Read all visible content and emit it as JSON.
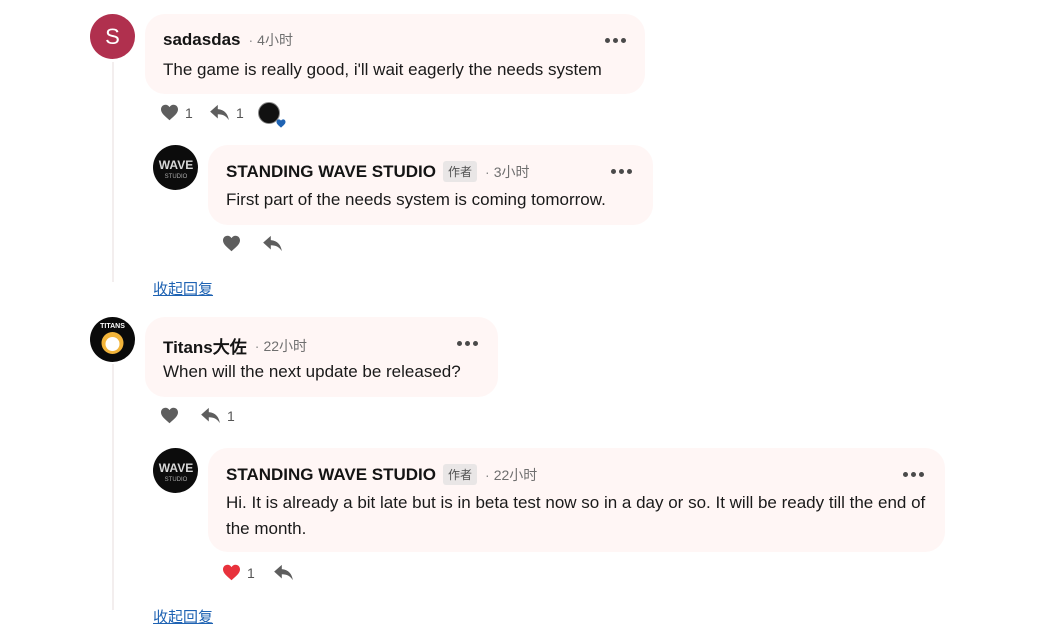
{
  "comments": [
    {
      "avatar_letter": "S",
      "author": "sadasdas",
      "time": "4小时",
      "text": "The game is really good, i'll wait eagerly the needs system",
      "like_count": "1",
      "reply_count": "1",
      "liked_by_author_icon": "heart-small-icon"
    },
    {
      "author": "STANDING WAVE STUDIO",
      "badge": "作者",
      "time": "3小时",
      "text": "First part of the needs system is coming tomorrow."
    },
    {
      "author": "Titans大佐",
      "time": "22小时",
      "text": "When will the next update be released?",
      "reply_count": "1"
    },
    {
      "author": "STANDING WAVE STUDIO",
      "badge": "作者",
      "time": "22小时",
      "text": "Hi. It is already a bit late but is in beta test now so in a day or so. It will be ready till the end of the month.",
      "like_count": "1"
    }
  ],
  "collapse_label": "收起回复",
  "studio_logo": {
    "line1": "WAVE",
    "line2": "STUDIO"
  },
  "titans_logo": {
    "line1": "TITANS"
  },
  "colors": {
    "accent_link": "#1f63b3",
    "heart_liked": "#e8323c",
    "bubble": "#fff6f5",
    "avatar_s": "#b0304e"
  }
}
